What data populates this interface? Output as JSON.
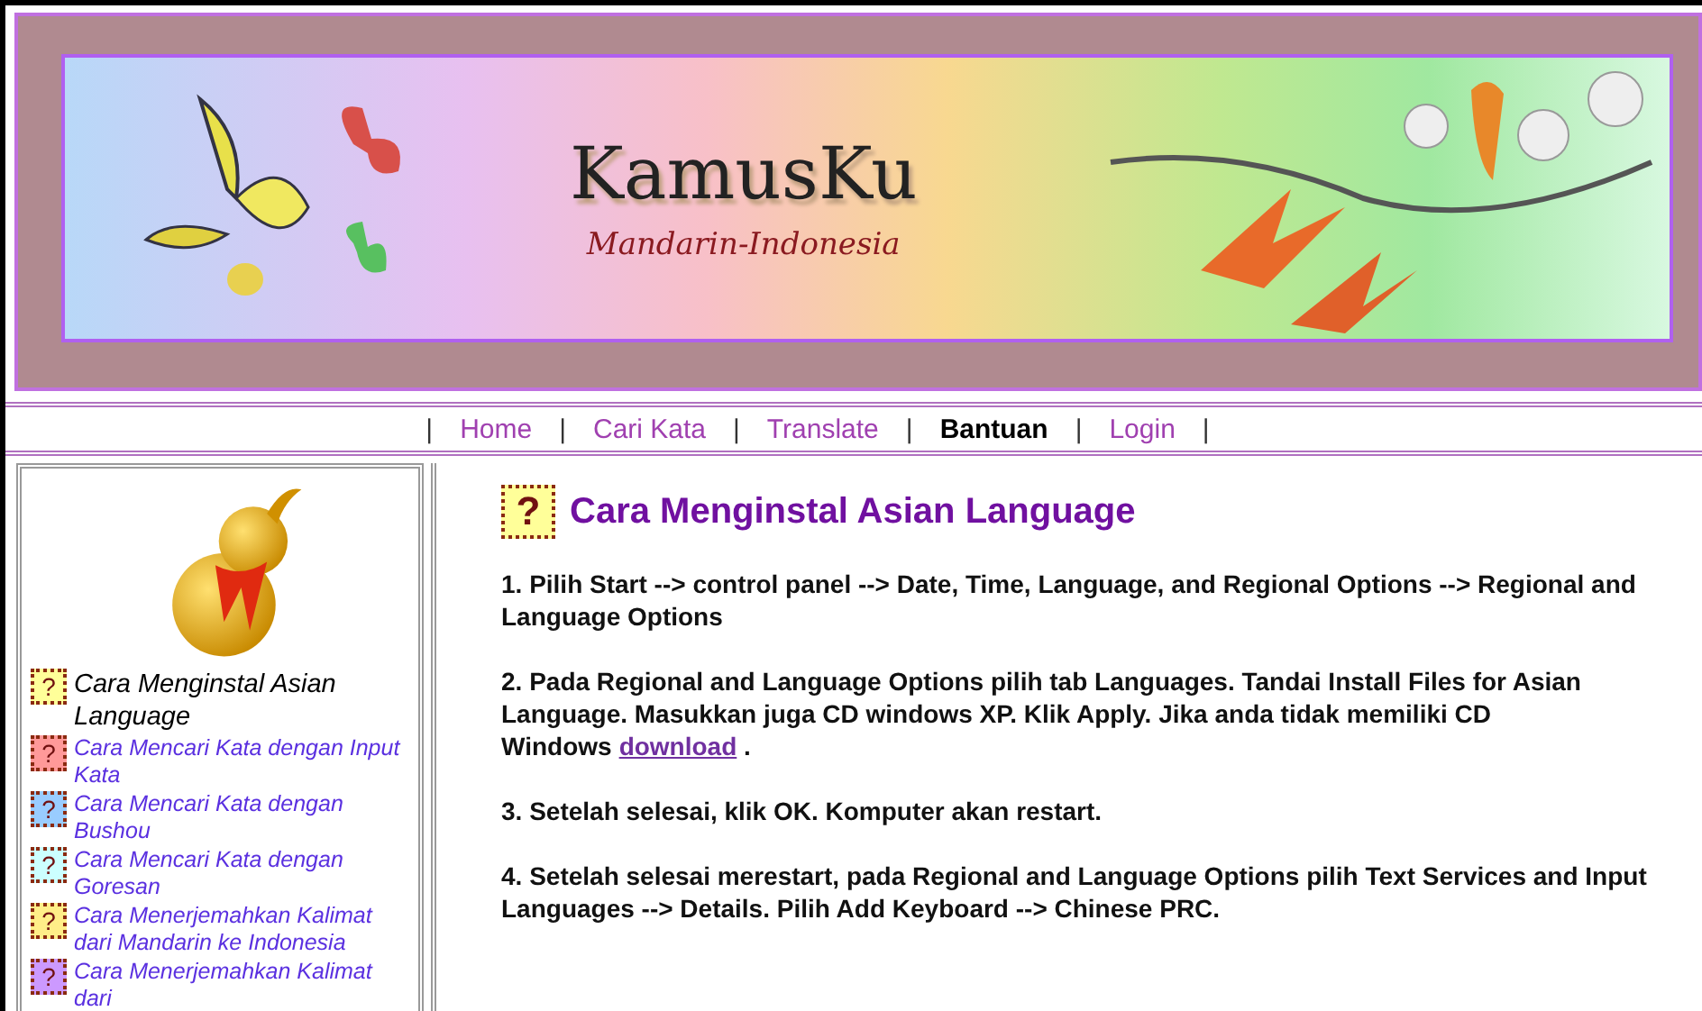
{
  "banner": {
    "title": "KamusKu",
    "subtitle": "Mandarin-Indonesia"
  },
  "nav": {
    "separator": "|",
    "items": [
      {
        "label": "Home",
        "selected": false
      },
      {
        "label": "Cari Kata",
        "selected": false
      },
      {
        "label": "Translate",
        "selected": false
      },
      {
        "label": "Bantuan",
        "selected": true
      },
      {
        "label": "Login",
        "selected": false
      }
    ]
  },
  "sidebar": {
    "items": [
      {
        "icon": "?",
        "label": "Cara Menginstal Asian Language",
        "selected": true,
        "color": "#ffff99"
      },
      {
        "icon": "?",
        "label": "Cara Mencari Kata dengan Input Kata",
        "selected": false,
        "color": "#ff9999"
      },
      {
        "icon": "?",
        "label": "Cara Mencari Kata dengan Bushou",
        "selected": false,
        "color": "#99ccff"
      },
      {
        "icon": "?",
        "label": "Cara Mencari Kata dengan Goresan",
        "selected": false,
        "color": "#ccffff"
      },
      {
        "icon": "?",
        "label": "Cara Menerjemahkan Kalimat dari Mandarin ke Indonesia",
        "selected": false,
        "color": "#ffee88"
      },
      {
        "icon": "?",
        "label": "Cara Menerjemahkan Kalimat dari",
        "selected": false,
        "color": "#cc99ff"
      }
    ]
  },
  "article": {
    "icon": "?",
    "title": "Cara Menginstal Asian Language",
    "steps": [
      {
        "text": "1. Pilih Start --> control panel --> Date, Time, Language, and Regional Options --> Regional and Language Options"
      },
      {
        "text": "2. Pada Regional and Language Options pilih tab Languages. Tandai Install Files for Asian Language. Masukkan juga CD windows XP. Klik Apply. Jika anda tidak memiliki CD Windows",
        "link": "download",
        "after": "."
      },
      {
        "text": "3. Setelah selesai, klik OK. Komputer akan restart."
      },
      {
        "text": "4. Setelah selesai merestart, pada Regional and Language Options pilih Text Services and Input Languages --> Details. Pilih Add Keyboard --> Chinese PRC."
      }
    ]
  }
}
